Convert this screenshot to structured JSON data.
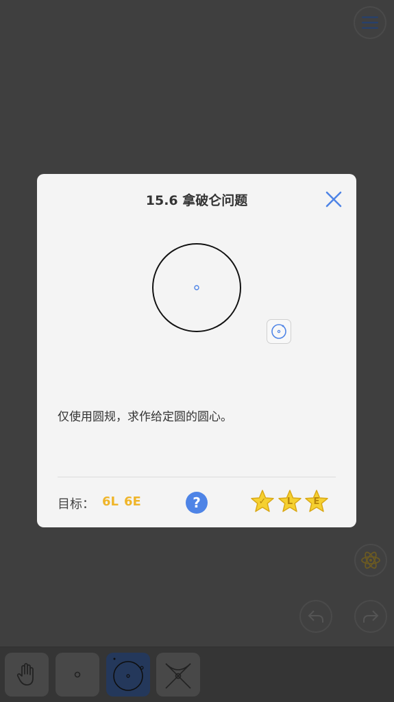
{
  "modal": {
    "title": "15.6 拿破仑问题",
    "description": "仅使用圆规，求作给定圆的圆心。",
    "goal_label": "目标：",
    "goal_lines": "6L",
    "goal_elementary": "6E",
    "help_label": "?",
    "stars": [
      {
        "letter": "✓"
      },
      {
        "letter": "L"
      },
      {
        "letter": "E"
      }
    ]
  },
  "colors": {
    "accent_blue": "#4e84e6",
    "goal_orange": "#efb52a",
    "star_yellow": "#f5d030"
  },
  "toolbar": {
    "tools": [
      "hand-tool",
      "point-tool",
      "circle-tool",
      "intersection-tool"
    ],
    "active": "circle-tool"
  }
}
